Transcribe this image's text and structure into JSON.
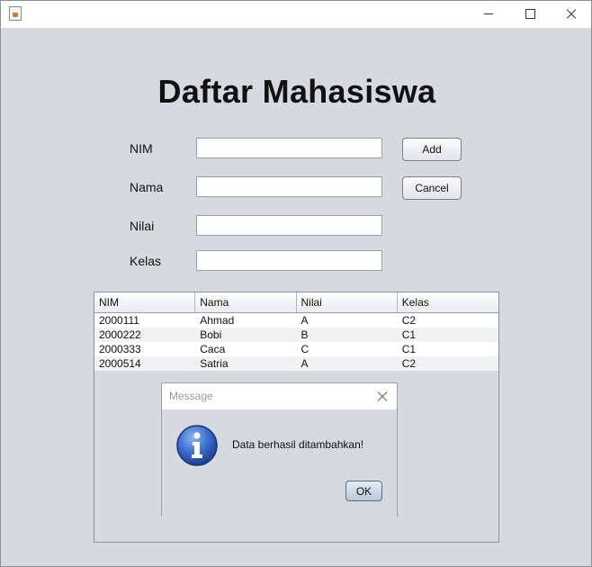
{
  "window": {
    "title": "",
    "icon": "java-icon"
  },
  "form": {
    "heading": "Daftar Mahasiswa",
    "nim_label": "NIM",
    "nama_label": "Nama",
    "nilai_label": "Nilai",
    "kelas_label": "Kelas",
    "nim_value": "",
    "nama_value": "",
    "nilai_value": "",
    "kelas_value": "",
    "add_label": "Add",
    "cancel_label": "Cancel"
  },
  "table": {
    "headers": [
      "NIM",
      "Nama",
      "Nilai",
      "Kelas"
    ],
    "rows": [
      [
        "2000111",
        "Ahmad",
        "A",
        "C2"
      ],
      [
        "2000222",
        "Bobi",
        "B",
        "C1"
      ],
      [
        "2000333",
        "Caca",
        "C",
        "C1"
      ],
      [
        "2000514",
        "Satria",
        "A",
        "C2"
      ]
    ]
  },
  "dialog": {
    "title": "Message",
    "message": "Data berhasil ditambahkan!",
    "ok_label": "OK",
    "icon": "info-icon"
  }
}
